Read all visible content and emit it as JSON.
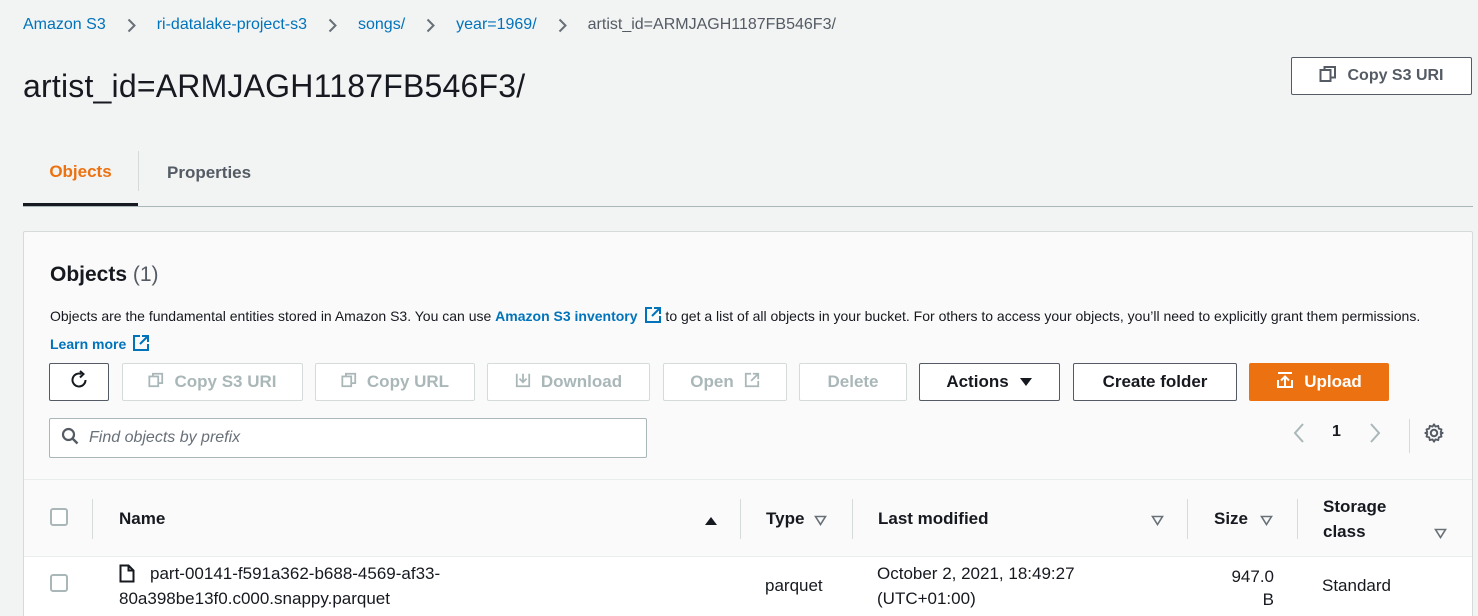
{
  "breadcrumb": {
    "items": [
      "Amazon S3",
      "ri-datalake-project-s3",
      "songs/",
      "year=1969/"
    ],
    "current": "artist_id=ARMJAGH1187FB546F3/"
  },
  "page": {
    "title": "artist_id=ARMJAGH1187FB546F3/",
    "copy_uri_label": "Copy S3 URI"
  },
  "tabs": [
    {
      "label": "Objects",
      "active": true
    },
    {
      "label": "Properties",
      "active": false
    }
  ],
  "objects_panel": {
    "title": "Objects",
    "count": "(1)",
    "description_part1": "Objects are the fundamental entities stored in Amazon S3. You can use ",
    "inventory_link": "Amazon S3 inventory",
    "description_part2": " to get a list of all objects in your bucket. For others to access your objects, you’ll need to explicitly grant them permissions. ",
    "learn_more": "Learn more"
  },
  "toolbar": {
    "copy_s3_uri": "Copy S3 URI",
    "copy_url": "Copy URL",
    "download": "Download",
    "open": "Open",
    "delete": "Delete",
    "actions": "Actions",
    "create_folder": "Create folder",
    "upload": "Upload"
  },
  "search": {
    "placeholder": "Find objects by prefix"
  },
  "pagination": {
    "current_page": "1"
  },
  "table": {
    "columns": {
      "name": "Name",
      "type": "Type",
      "last_modified": "Last modified",
      "size": "Size",
      "storage_class_line1": "Storage",
      "storage_class_line2": "class"
    },
    "rows": [
      {
        "name_line1": "part-00141-f591a362-b688-4569-af33-",
        "name_line2": "80a398be13f0.c000.snappy.parquet",
        "type": "parquet",
        "last_modified_line1": "October 2, 2021, 18:49:27",
        "last_modified_line2": "(UTC+01:00)",
        "size_line1": "947.0",
        "size_line2": "B",
        "storage_class": "Standard"
      }
    ]
  },
  "colors": {
    "link": "#0073bb",
    "accent_orange": "#ec7211",
    "background": "#f2f3f3"
  }
}
